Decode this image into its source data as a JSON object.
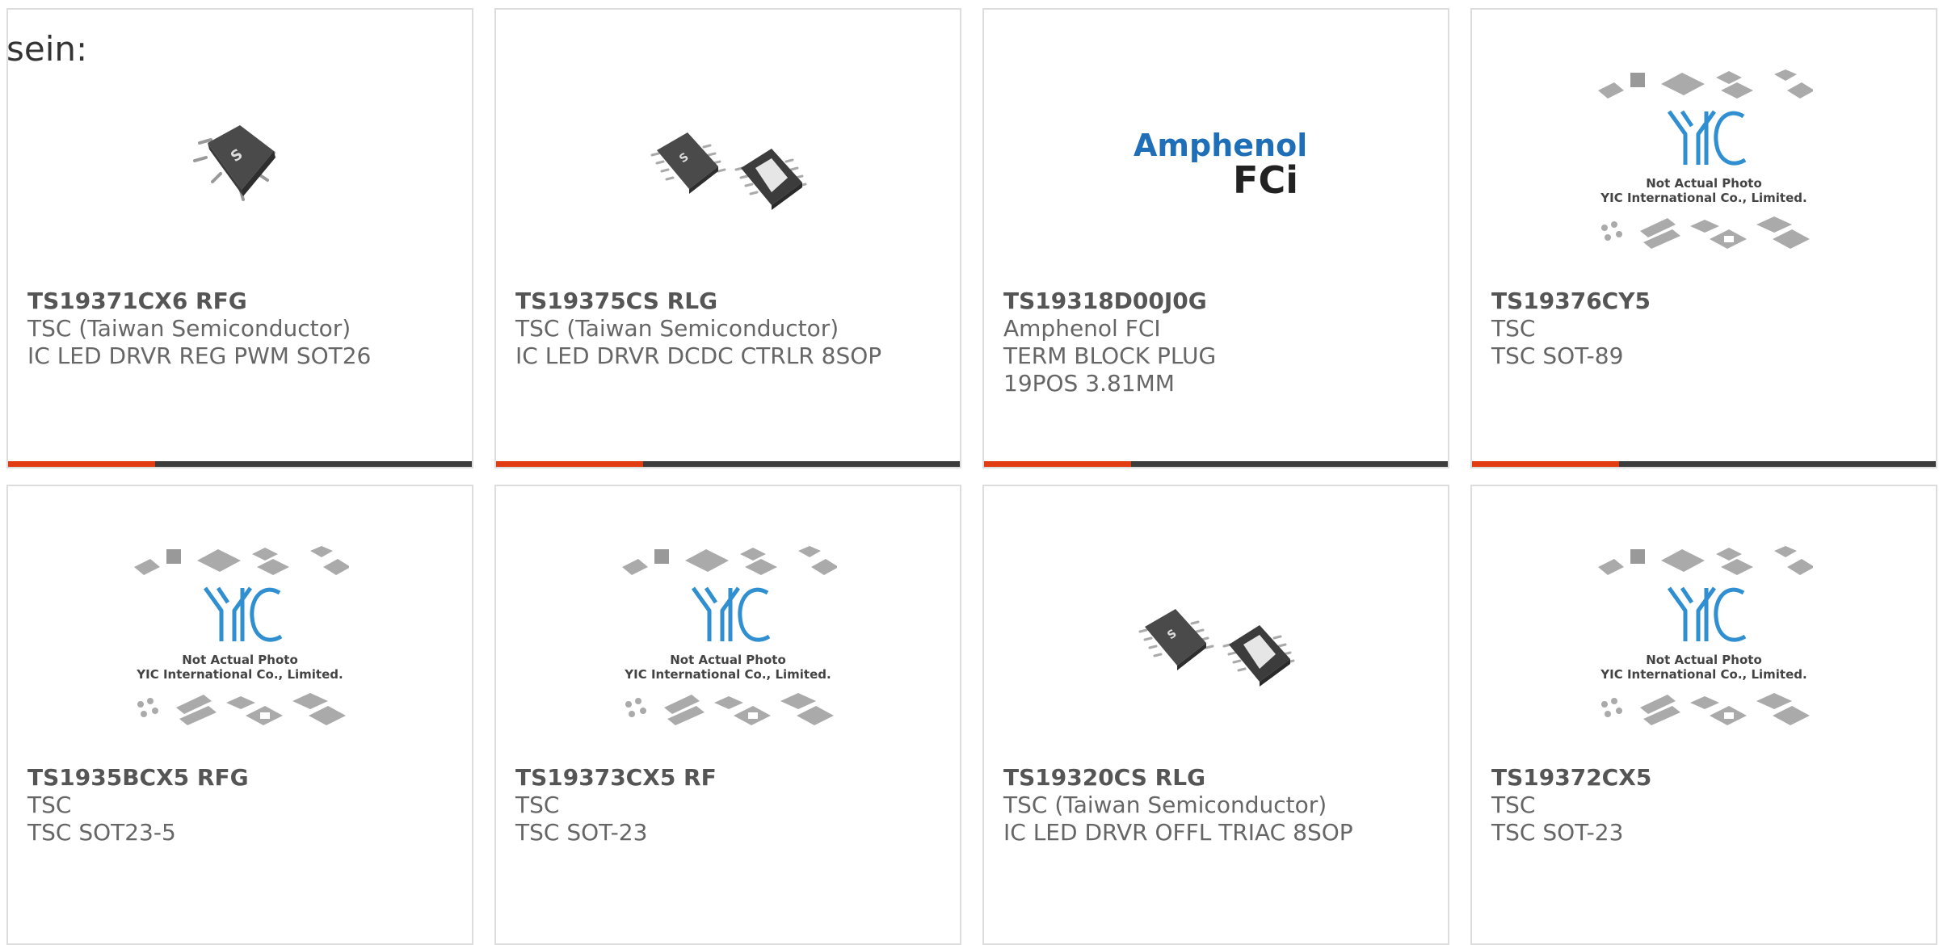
{
  "heading": "sein:",
  "colors": {
    "accent": "#e23d12",
    "bar": "#3c3c3c",
    "border": "#dddddd",
    "yic_blue": "#2f8fd0"
  },
  "image_texts": {
    "amphenol_line1": "Amphenol",
    "amphenol_line2": "FCi",
    "yic_line1": "Not Actual Photo",
    "yic_line2": "YIC International Co., Limited."
  },
  "products": [
    {
      "part": "TS19371CX6 RFG",
      "manufacturer": "TSC (Taiwan Semiconductor)",
      "description": "IC LED DRVR REG PWM SOT26",
      "image": "sot26-chip"
    },
    {
      "part": "TS19375CS RLG",
      "manufacturer": "TSC (Taiwan Semiconductor)",
      "description": "IC LED DRVR DCDC CTRLR 8SOP",
      "image": "sop8-chips"
    },
    {
      "part": "TS19318D00J0G",
      "manufacturer": "Amphenol FCI",
      "description": "TERM BLOCK PLUG 19POS 3.81MM",
      "image": "amphenol-logo"
    },
    {
      "part": "TS19376CY5",
      "manufacturer": "TSC",
      "description": "TSC SOT-89",
      "image": "yic-placeholder"
    },
    {
      "part": "TS1935BCX5 RFG",
      "manufacturer": "TSC",
      "description": "TSC SOT23-5",
      "image": "yic-placeholder"
    },
    {
      "part": "TS19373CX5 RF",
      "manufacturer": "TSC",
      "description": "TSC SOT-23",
      "image": "yic-placeholder"
    },
    {
      "part": "TS19320CS RLG",
      "manufacturer": "TSC (Taiwan Semiconductor)",
      "description": "IC LED DRVR OFFL TRIAC 8SOP",
      "image": "sop8-chips"
    },
    {
      "part": "TS19372CX5",
      "manufacturer": "TSC",
      "description": "TSC SOT-23",
      "image": "yic-placeholder"
    }
  ]
}
